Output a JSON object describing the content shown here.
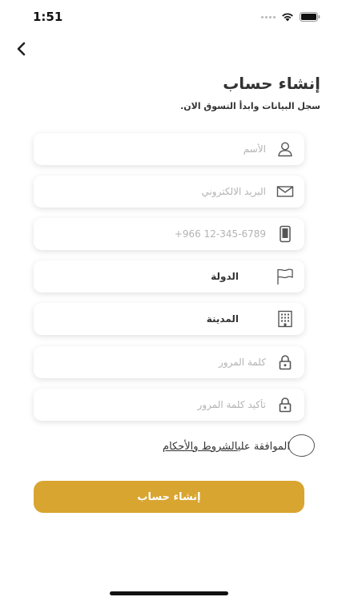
{
  "status_bar": {
    "time": "1:51"
  },
  "header": {
    "title": "إنشاء حساب",
    "subtitle": "سجل البيانات وابدأ التسوق الان."
  },
  "form": {
    "name_placeholder": "الأسم",
    "email_placeholder": "البريد الالكتروني",
    "phone_placeholder": "+966 12-345-6789",
    "country_label": "الدولة",
    "city_label": "المدينة",
    "password_placeholder": "كلمة المرور",
    "confirm_password_placeholder": "تأكيد كلمة المرور"
  },
  "agreement": {
    "prefix": "الموافقة علي",
    "link": "الشروط والأحكام"
  },
  "submit_label": "إنشاء حساب",
  "colors": {
    "accent": "#d9a531"
  },
  "icons": {
    "back": "chevron-left-icon",
    "name": "user-icon",
    "email": "mail-icon",
    "phone": "phone-icon",
    "country": "flag-icon",
    "city": "building-icon",
    "password": "lock-icon"
  }
}
